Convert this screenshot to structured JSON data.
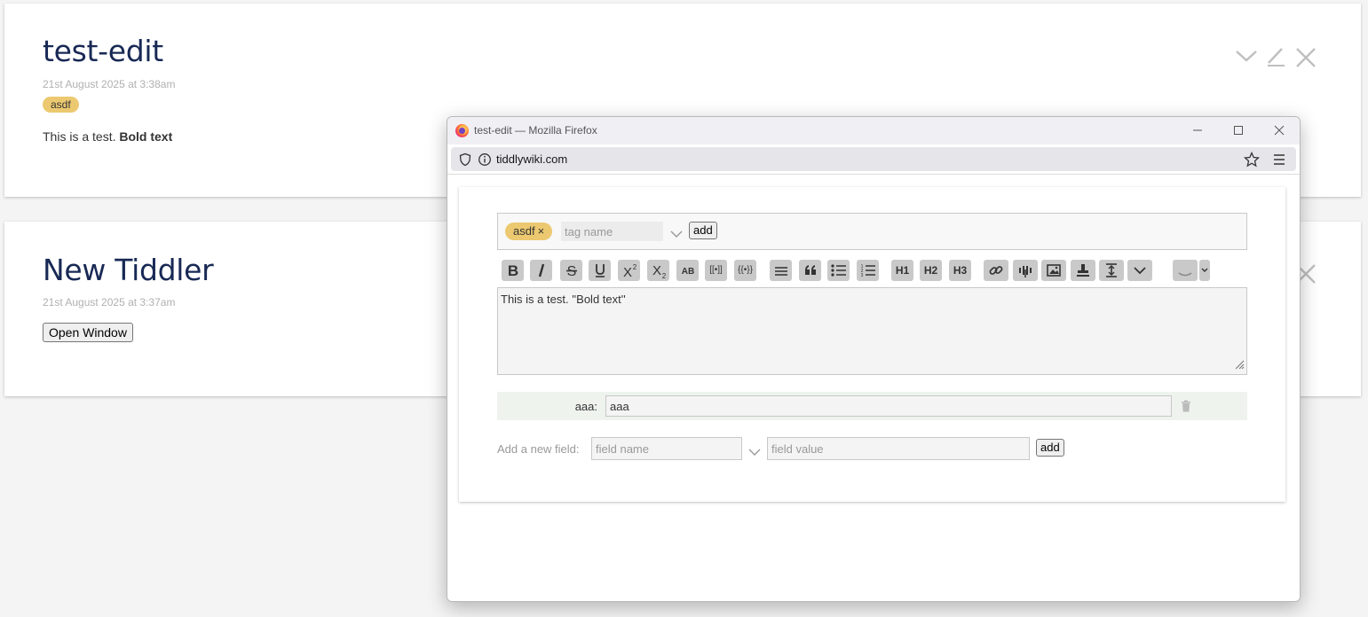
{
  "tiddlers": [
    {
      "title": "test-edit",
      "subtitle": "21st August 2025 at 3:38am",
      "tag": "asdf",
      "body_plain": "This is a test. ",
      "body_bold": "Bold text"
    },
    {
      "title": "New Tiddler",
      "subtitle": "21st August 2025 at 3:37am",
      "button_label": "Open Window"
    }
  ],
  "popup": {
    "window_title": "test-edit — Mozilla Firefox",
    "url": "tiddlywiki.com",
    "editor": {
      "tag": "asdf",
      "tag_remove": "×",
      "tag_placeholder": "tag name",
      "tag_add_label": "add",
      "toolbar": {
        "h1": "H1",
        "h2": "H2",
        "h3": "H3",
        "transclude": "[[•]]",
        "macro": "{{•}}"
      },
      "body_text": "This is a test. ''Bold text''",
      "field": {
        "name": "aaa:",
        "value": "aaa"
      },
      "new_field_label": "Add a new field:",
      "field_name_placeholder": "field name",
      "field_value_placeholder": "field value",
      "new_field_add_label": "add"
    }
  },
  "colors": {
    "title": "#182955",
    "tag": "#ecc970",
    "muted": "#b0b0b0",
    "toolbar_button": "#c9c9c9"
  },
  "icons": [
    "chevron-down-icon",
    "edit-icon",
    "close-icon",
    "firefox-logo-icon",
    "shield-icon",
    "info-icon",
    "star-icon",
    "menu-icon",
    "trash-icon"
  ]
}
